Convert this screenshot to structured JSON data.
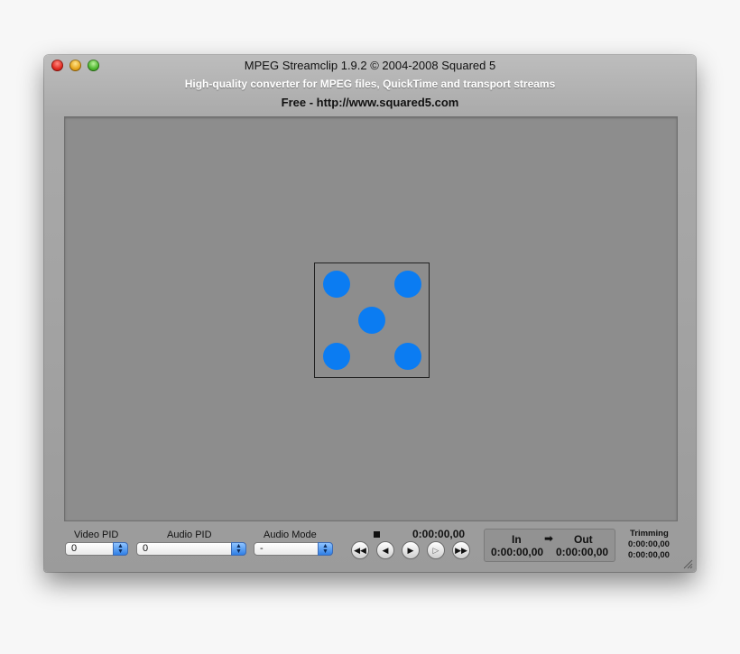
{
  "window": {
    "title": "MPEG Streamclip 1.9.2 © 2004-2008 Squared 5",
    "subtitle": "High-quality converter for MPEG files, QuickTime and transport streams",
    "free_line": "Free  -  http://www.squared5.com"
  },
  "viewer": {
    "placeholder_icon": "dice-five-icon",
    "dot_color": "#0b7cf2"
  },
  "controls": {
    "video_pid": {
      "label": "Video PID",
      "value": "0"
    },
    "audio_pid": {
      "label": "Audio PID",
      "value": "0"
    },
    "audio_mode": {
      "label": "Audio Mode",
      "value": "-"
    },
    "current_time": "0:00:00,00",
    "transport": {
      "rewind_icon": "fast-backward-icon",
      "step_back_icon": "step-back-icon",
      "play_icon": "play-icon",
      "play_outline_icon": "play-outline-icon",
      "fast_forward_icon": "fast-forward-icon",
      "stop_icon": "stop-icon"
    },
    "in_out": {
      "in_label": "In",
      "arrow": "➡",
      "out_label": "Out",
      "in_time": "0:00:00,00",
      "out_time": "0:00:00,00"
    },
    "trimming": {
      "label": "Trimming",
      "value1": "0:00:00,00",
      "value2": "0:00:00,00"
    }
  }
}
